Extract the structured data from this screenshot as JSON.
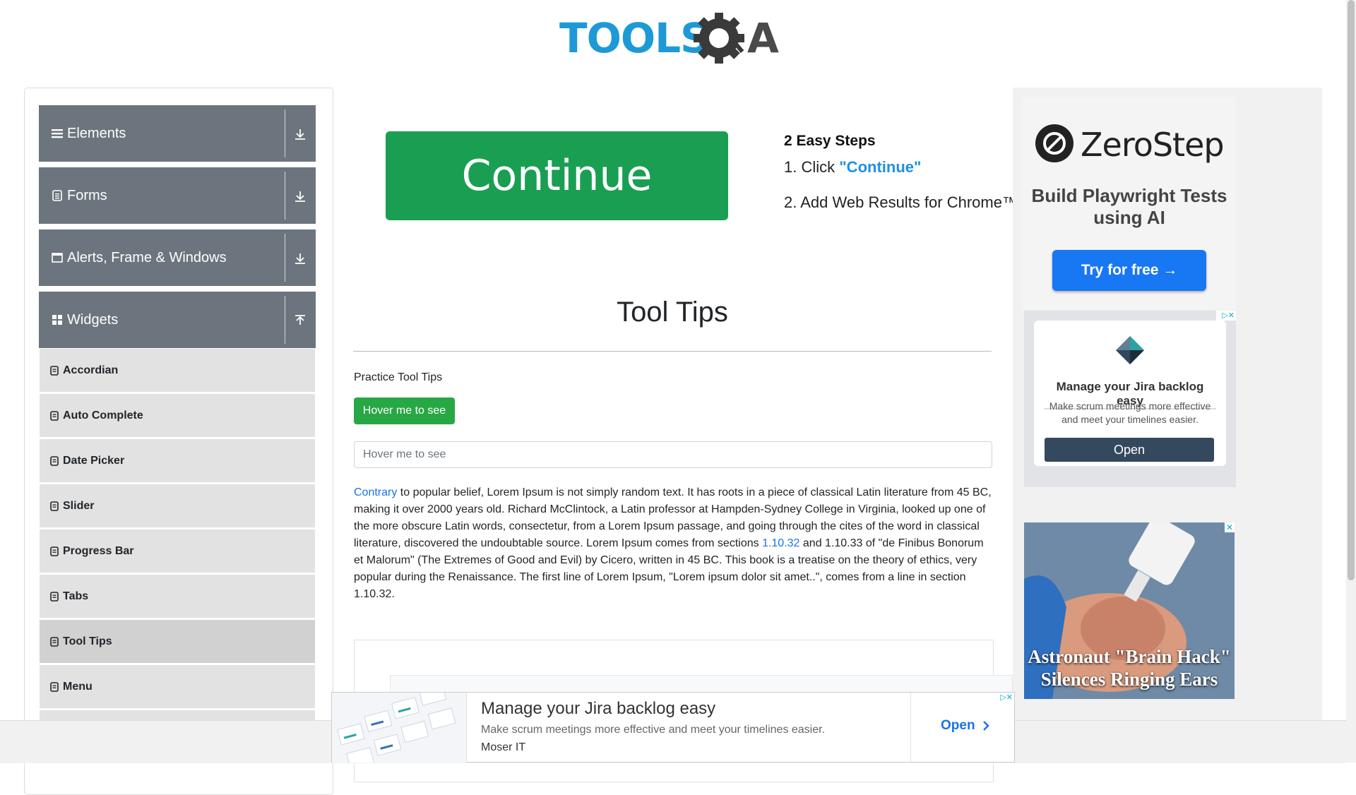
{
  "header": {
    "logo_text_left": "TOOLS",
    "logo_text_right": "A"
  },
  "sidebar": {
    "groups": [
      {
        "label": "Elements",
        "icon": "hamburger-icon",
        "state": "collapsed"
      },
      {
        "label": "Forms",
        "icon": "document-icon",
        "state": "collapsed"
      },
      {
        "label": "Alerts, Frame & Windows",
        "icon": "window-icon",
        "state": "collapsed"
      },
      {
        "label": "Widgets",
        "icon": "grid-icon",
        "state": "expanded"
      }
    ],
    "items": [
      {
        "label": "Accordian"
      },
      {
        "label": "Auto Complete"
      },
      {
        "label": "Date Picker"
      },
      {
        "label": "Slider"
      },
      {
        "label": "Progress Bar"
      },
      {
        "label": "Tabs"
      },
      {
        "label": "Tool Tips",
        "active": true
      },
      {
        "label": "Menu"
      }
    ]
  },
  "top_ad": {
    "button": "Continue",
    "steps_title": "2 Easy Steps",
    "step1_prefix": "1. Click ",
    "step1_highlight": "\"Continue\"",
    "step2": "2. Add Web Results for Chrome™"
  },
  "main": {
    "title": "Tool Tips",
    "practice_label": "Practice Tool Tips",
    "hover_button": "Hover me to see",
    "hover_input_placeholder": "Hover me to see",
    "para_link1": "Contrary",
    "para_text1": " to popular belief, Lorem Ipsum is not simply random text. It has roots in a piece of classical Latin literature from 45 BC, making it over 2000 years old. Richard McClintock, a Latin professor at Hampden-Sydney College in Virginia, looked up one of the more obscure Latin words, consectetur, from a Lorem Ipsum passage, and going through the cites of the word in classical literature, discovered the undoubtable source. Lorem Ipsum comes from sections ",
    "para_link2": "1.10.32",
    "para_text2": " and 1.10.33 of \"de Finibus Bonorum et Malorum\" (The Extremes of Good and Evil) by Cicero, written in 45 BC. This book is a treatise on the theory of ethics, very popular during the Renaissance. The first line of Lorem Ipsum, \"Lorem ipsum dolor sit amet..\", comes from a line in section 1.10.32."
  },
  "right_ads": {
    "zerostep_name": "ZeroStep",
    "zerostep_tagline": "Build Playwright Tests using AI",
    "zerostep_cta": "Try for free →",
    "jira_title": "Manage your Jira backlog easy",
    "jira_desc": "Make scrum meetings more effective and meet your timelines easier.",
    "jira_cta": "Open",
    "astro_title": "Astronaut \"Brain Hack\" Silences Ringing Ears"
  },
  "bottom_ad": {
    "title": "Manage your Jira backlog easy",
    "desc": "Make scrum meetings more effective and meet your timelines easier.",
    "brand": "Moser IT",
    "cta": "Open"
  },
  "colors": {
    "sidebar_header": "#6c757d",
    "sidebar_item": "#e2e2e2",
    "primary_green": "#28a745",
    "link_blue": "#1a73e8"
  }
}
